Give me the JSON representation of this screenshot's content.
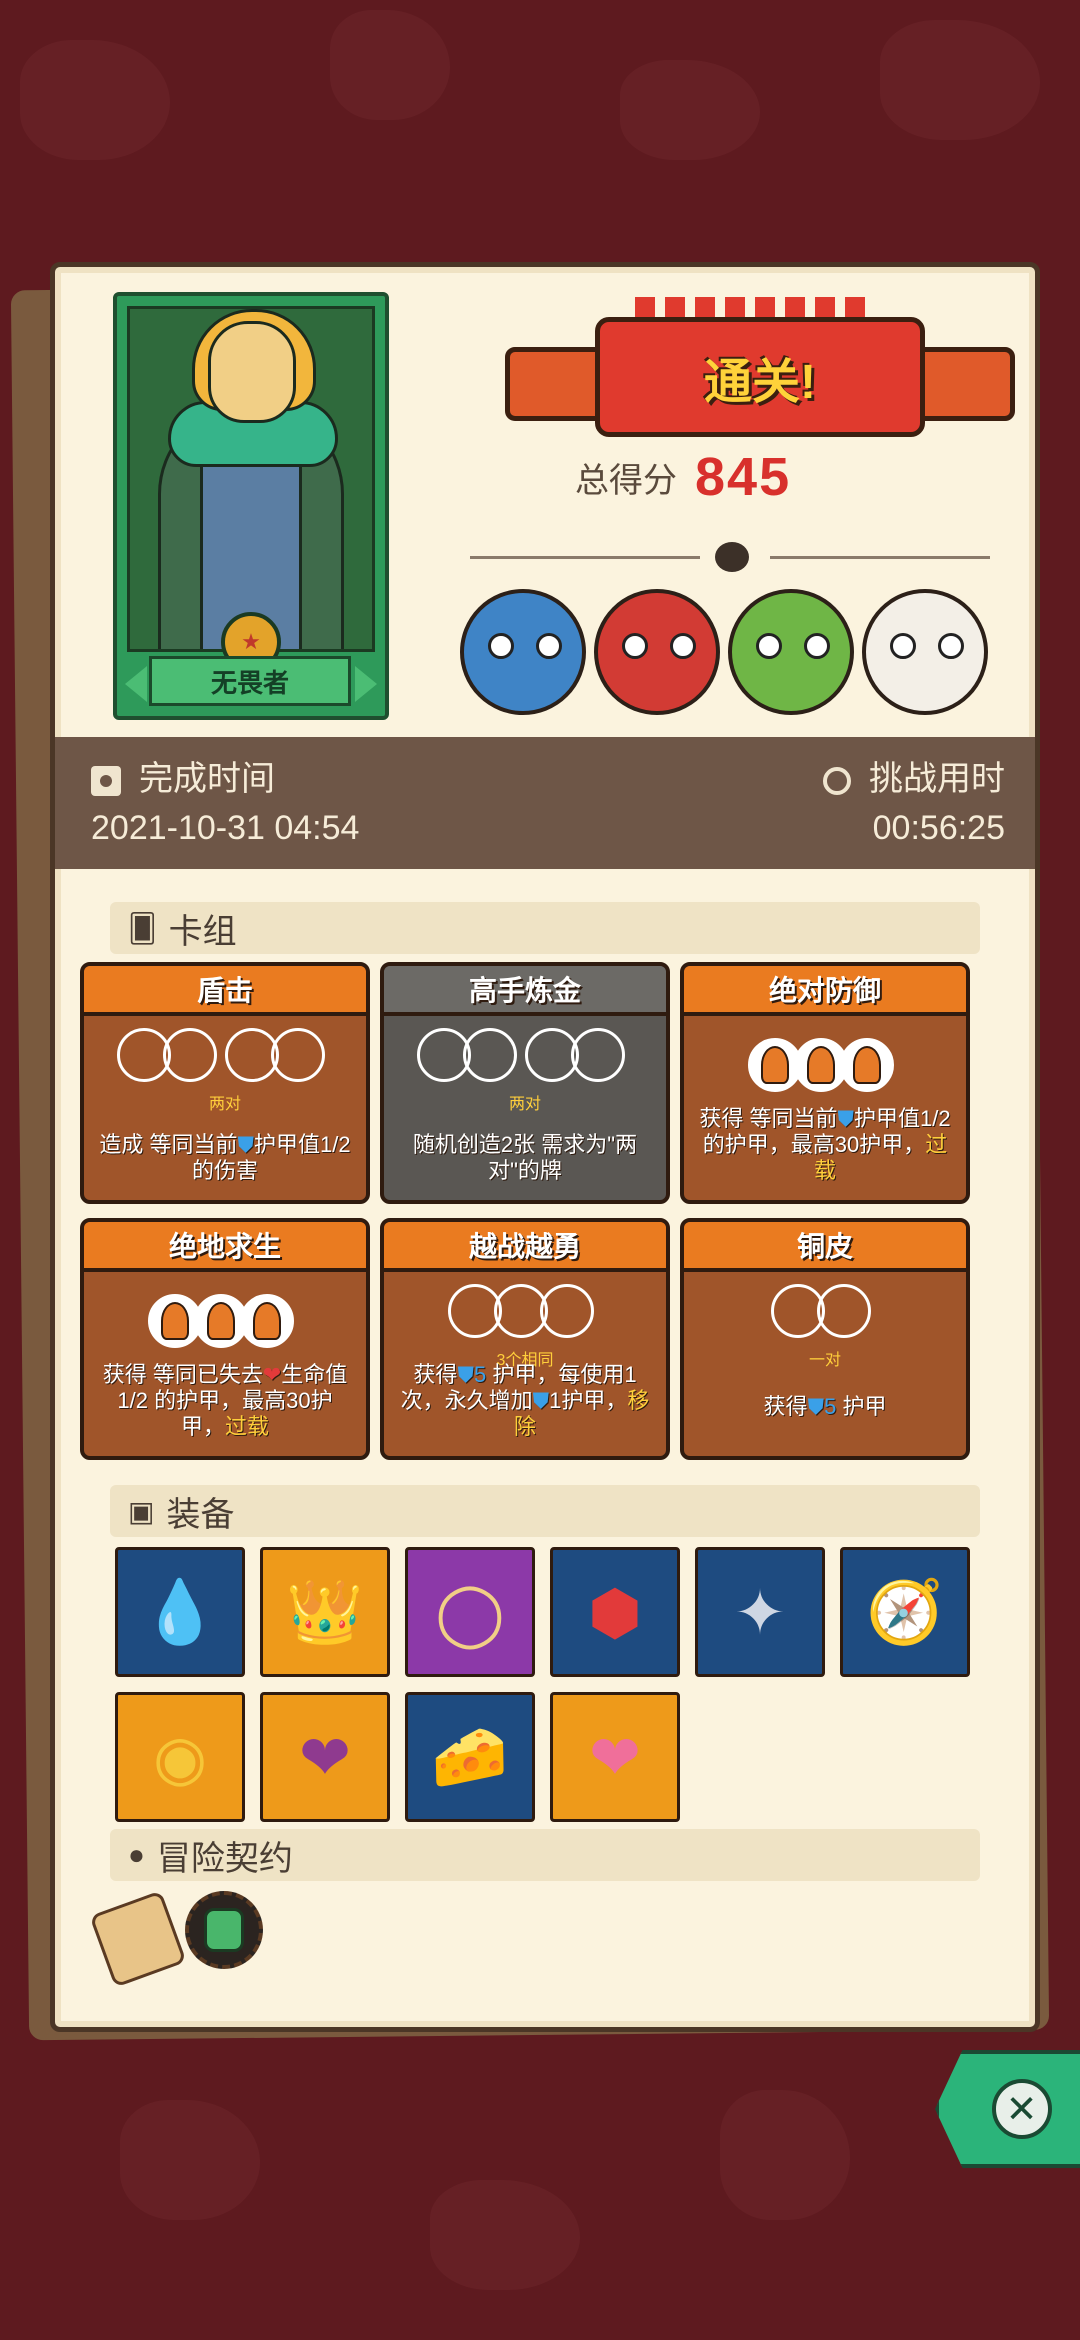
{
  "hero": {
    "title": "无畏者",
    "badge_icon": "medal-icon"
  },
  "banner": {
    "text": "通关!"
  },
  "score": {
    "label": "总得分",
    "value": "845"
  },
  "bosses": [
    {
      "name": "blue-monster",
      "color": "#3f84c6"
    },
    {
      "name": "red-demon",
      "color": "#d23b34"
    },
    {
      "name": "green-goblin-king",
      "color": "#6fb646"
    },
    {
      "name": "white-lion-mask",
      "color": "#f3efe7"
    }
  ],
  "times": {
    "finish_label": "完成时间",
    "finish_value": "2021-10-31 04:54",
    "challenge_label": "挑战用时",
    "challenge_value": "00:56:25"
  },
  "sections": {
    "deck": "卡组",
    "equipment": "装备",
    "contract": "冒险契约"
  },
  "cards": [
    {
      "title": "盾击",
      "tag": "两对",
      "desc_pre": "造成 等同当前",
      "desc_post": "护甲值1/2的伤害",
      "style": "orange",
      "circles": "pairs"
    },
    {
      "title": "高手炼金",
      "tag": "两对",
      "desc": "随机创造2张 需求为\"两对\"的牌",
      "style": "gray",
      "circles": "pairs"
    },
    {
      "title": "绝对防御",
      "tag": "",
      "desc_pre": "获得 等同当前",
      "desc_post": "护甲值1/2的护甲，最高30护甲，",
      "desc_yellow": "过载",
      "style": "orange",
      "circles": "flames"
    },
    {
      "title": "绝地求生",
      "tag": "",
      "desc_pre": "获得 等同已失去",
      "desc_post": "生命值1/2 的护甲，最高30护甲，",
      "desc_yellow": "过载",
      "style": "orange",
      "circles": "flames"
    },
    {
      "title": "越战越勇",
      "tag": "3个相同",
      "desc_pre": "获得",
      "desc_num": "5",
      "desc_mid": " 护甲，每使用1次，永久增加",
      "desc_post": "1护甲，",
      "desc_yellow": "移除",
      "style": "orange",
      "circles": "triple"
    },
    {
      "title": "铜皮",
      "tag": "一对",
      "desc_pre": "获得",
      "desc_num": "5",
      "desc_post": " 护甲",
      "style": "orange",
      "circles": "single"
    }
  ],
  "equipment": [
    {
      "name": "water-gem",
      "bg": "blue",
      "glyph": "💧"
    },
    {
      "name": "golden-crown",
      "bg": "orange",
      "glyph": "👑"
    },
    {
      "name": "magic-mirror",
      "bg": "purple",
      "glyph": "🪞"
    },
    {
      "name": "ruby",
      "bg": "blue",
      "glyph": "🔴"
    },
    {
      "name": "silver-star-emblem",
      "bg": "blue",
      "glyph": "✧"
    },
    {
      "name": "compass-armor",
      "bg": "blue",
      "glyph": "🧭"
    },
    {
      "name": "gold-coin",
      "bg": "orange",
      "glyph": "🪙"
    },
    {
      "name": "cursed-heart",
      "bg": "orange",
      "glyph": "💜"
    },
    {
      "name": "cheese-sprout",
      "bg": "blue",
      "glyph": "🧀"
    },
    {
      "name": "heart-box",
      "bg": "orange",
      "glyph": "💗"
    }
  ],
  "contracts": [
    {
      "name": "scroll"
    },
    {
      "name": "potion-medal"
    }
  ]
}
